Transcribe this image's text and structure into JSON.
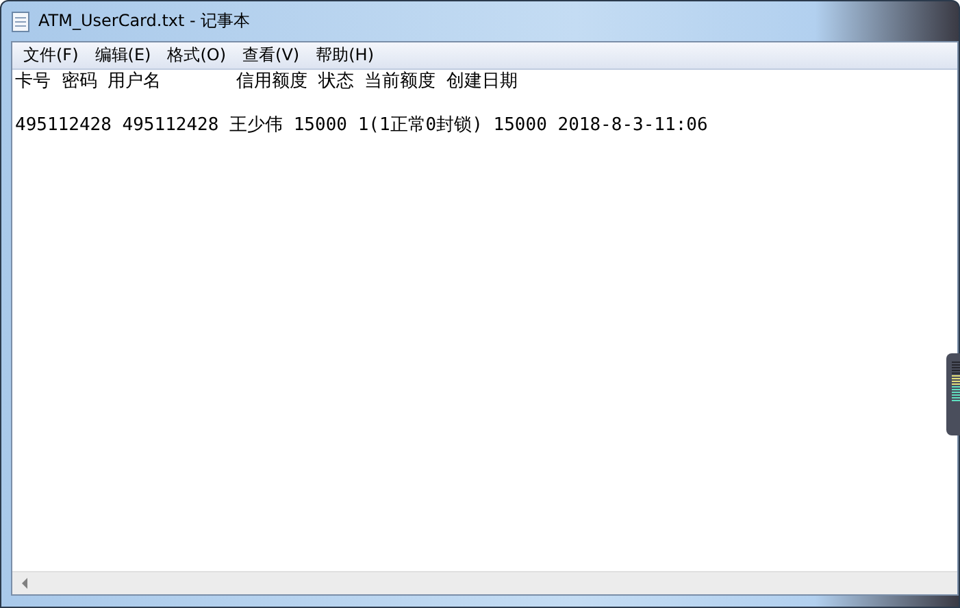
{
  "window": {
    "title": "ATM_UserCard.txt - 记事本"
  },
  "menu": [
    "文件(F)",
    "编辑(E)",
    "格式(O)",
    "查看(V)",
    "帮助(H)"
  ],
  "editor": {
    "lines": [
      "卡号 密码 用户名       信用额度 状态 当前额度 创建日期",
      "495112428 495112428 王少伟 15000 1(1正常0封锁) 15000 2018-8-3-11:06"
    ]
  }
}
